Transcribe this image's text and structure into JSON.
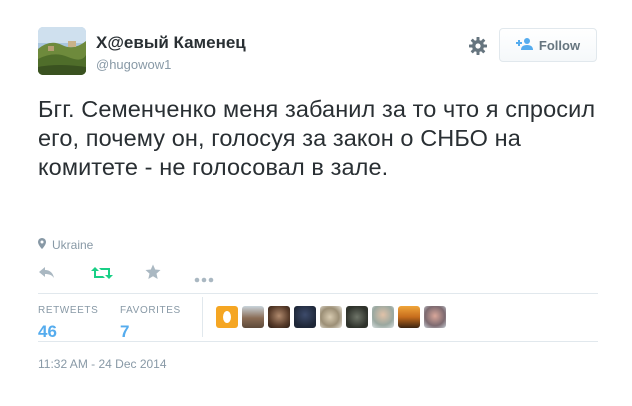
{
  "user": {
    "display_name": "Х@евый Каменец",
    "handle": "@hugowow1"
  },
  "follow_label": "Follow",
  "tweet": {
    "text": "Бгг. Семенченко меня забанил за то что я спросил его, почему он, голосуя за закон о СНБО на комитете - не голосовал в зале.",
    "location": "Ukraine"
  },
  "stats": {
    "retweets_label": "RETWEETS",
    "retweets_count": "46",
    "favorites_label": "FAVORITES",
    "favorites_count": "7"
  },
  "timestamp": "11:32 AM - 24 Dec 2014",
  "colors": {
    "retweet_green": "#19cf86",
    "accent_blue": "#55acee",
    "muted": "#8899a6",
    "text": "#292f33"
  },
  "icons": [
    "gear-icon",
    "follow-user-icon",
    "location-pin-icon",
    "reply-icon",
    "retweet-icon",
    "favorite-star-icon",
    "more-dots-icon"
  ]
}
